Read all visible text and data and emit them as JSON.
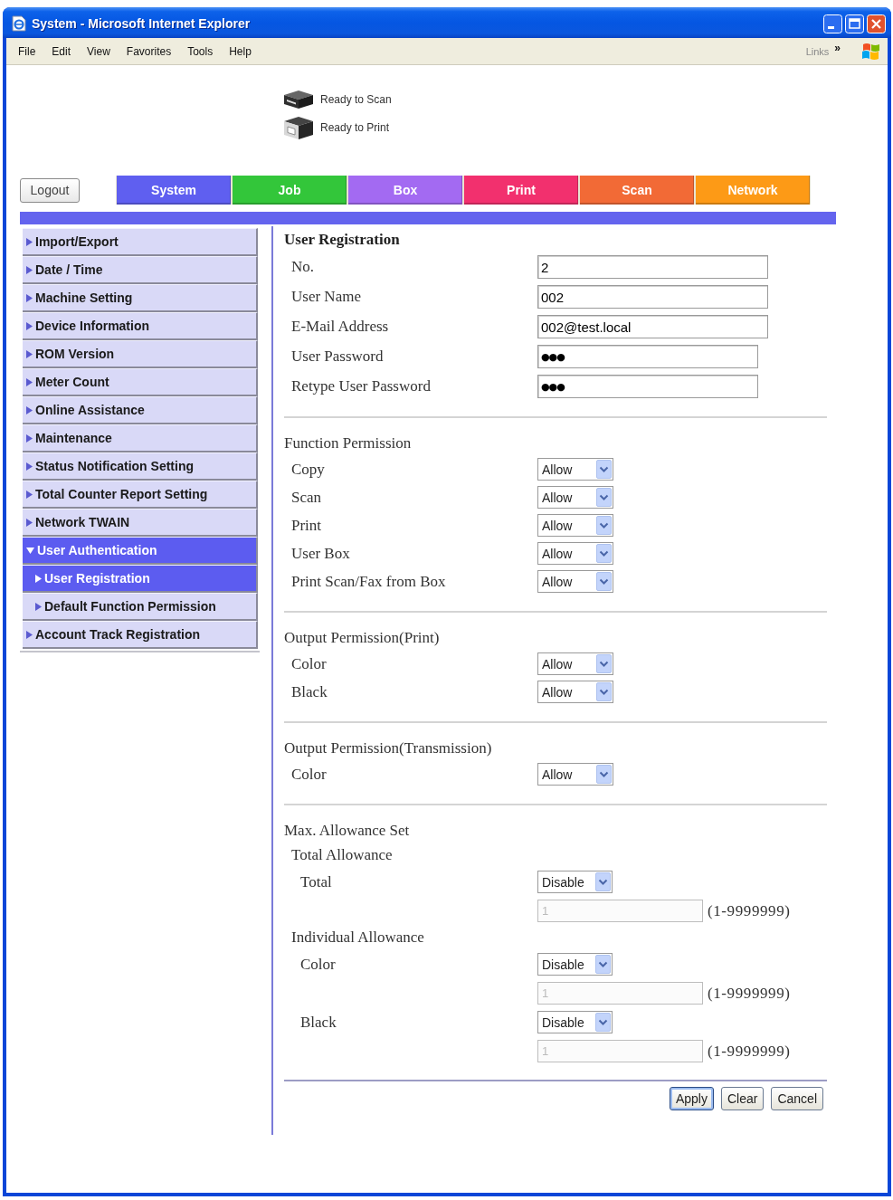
{
  "window": {
    "title": "System - Microsoft Internet Explorer"
  },
  "menu_bar": {
    "items": [
      "File",
      "Edit",
      "View",
      "Favorites",
      "Tools",
      "Help"
    ],
    "links": "Links",
    "chevron": "»"
  },
  "device_status": [
    {
      "kind": "scanner",
      "text": "Ready to Scan"
    },
    {
      "kind": "printer",
      "text": "Ready to Print"
    }
  ],
  "logout": "Logout",
  "tabs": [
    {
      "label": "System",
      "color": "#5f5ff0"
    },
    {
      "label": "Job",
      "color": "#33c63a"
    },
    {
      "label": "Box",
      "color": "#a36af2"
    },
    {
      "label": "Print",
      "color": "#f2306e"
    },
    {
      "label": "Scan",
      "color": "#f26a36"
    },
    {
      "label": "Network",
      "color": "#fd9a16"
    }
  ],
  "sidebar": {
    "items": [
      {
        "label": "Import/Export",
        "selected": false,
        "expanded": false
      },
      {
        "label": "Date / Time",
        "selected": false,
        "expanded": false
      },
      {
        "label": "Machine Setting",
        "selected": false,
        "expanded": false
      },
      {
        "label": "Device Information",
        "selected": false,
        "expanded": false
      },
      {
        "label": "ROM Version",
        "selected": false,
        "expanded": false
      },
      {
        "label": "Meter Count",
        "selected": false,
        "expanded": false
      },
      {
        "label": "Online Assistance",
        "selected": false,
        "expanded": false
      },
      {
        "label": "Maintenance",
        "selected": false,
        "expanded": false
      },
      {
        "label": "Status Notification Setting",
        "selected": false,
        "expanded": false
      },
      {
        "label": "Total Counter Report Setting",
        "selected": false,
        "expanded": false
      },
      {
        "label": "Network TWAIN",
        "selected": false,
        "expanded": false
      },
      {
        "label": "User Authentication",
        "selected": true,
        "expanded": true,
        "children": [
          {
            "label": "User Registration",
            "selected": true
          },
          {
            "label": "Default Function Permission",
            "selected": false
          }
        ]
      },
      {
        "label": "Account Track Registration",
        "selected": false,
        "expanded": false
      }
    ]
  },
  "user_registration": {
    "title": "User Registration",
    "fields": [
      {
        "label": "No.",
        "value": "2",
        "kind": "text"
      },
      {
        "label": "User Name",
        "value": "002",
        "kind": "text"
      },
      {
        "label": "E-Mail Address",
        "value": "002@test.local",
        "kind": "text"
      },
      {
        "label": "User Password",
        "value": "●●●",
        "kind": "password"
      },
      {
        "label": "Retype User Password",
        "value": "●●●",
        "kind": "password"
      }
    ]
  },
  "permission_sections": [
    {
      "title": "Function Permission",
      "rows": [
        {
          "label": "Copy",
          "value": "Allow"
        },
        {
          "label": "Scan",
          "value": "Allow"
        },
        {
          "label": "Print",
          "value": "Allow"
        },
        {
          "label": "User Box",
          "value": "Allow"
        },
        {
          "label": "Print Scan/Fax from Box",
          "value": "Allow"
        }
      ]
    },
    {
      "title": "Output Permission(Print)",
      "rows": [
        {
          "label": "Color",
          "value": "Allow"
        },
        {
          "label": "Black",
          "value": "Allow"
        }
      ]
    },
    {
      "title": "Output Permission(Transmission)",
      "rows": [
        {
          "label": "Color",
          "value": "Allow"
        }
      ]
    }
  ],
  "max_allowance": {
    "title": "Max. Allowance Set",
    "groups": [
      {
        "title": "Total Allowance",
        "rows": [
          {
            "label": "Total",
            "value": "Disable",
            "amount": {
              "value": "1",
              "disabled": true
            },
            "range": "(1-9999999)"
          }
        ]
      },
      {
        "title": "Individual Allowance",
        "rows": [
          {
            "label": "Color",
            "value": "Disable",
            "amount": {
              "value": "1",
              "disabled": true
            },
            "range": "(1-9999999)"
          },
          {
            "label": "Black",
            "value": "Disable",
            "amount": {
              "value": "1",
              "disabled": true
            },
            "range": "(1-9999999)"
          }
        ]
      }
    ]
  },
  "buttons": [
    {
      "label": "Apply",
      "default": true
    },
    {
      "label": "Clear",
      "default": false
    },
    {
      "label": "Cancel",
      "default": false
    }
  ]
}
